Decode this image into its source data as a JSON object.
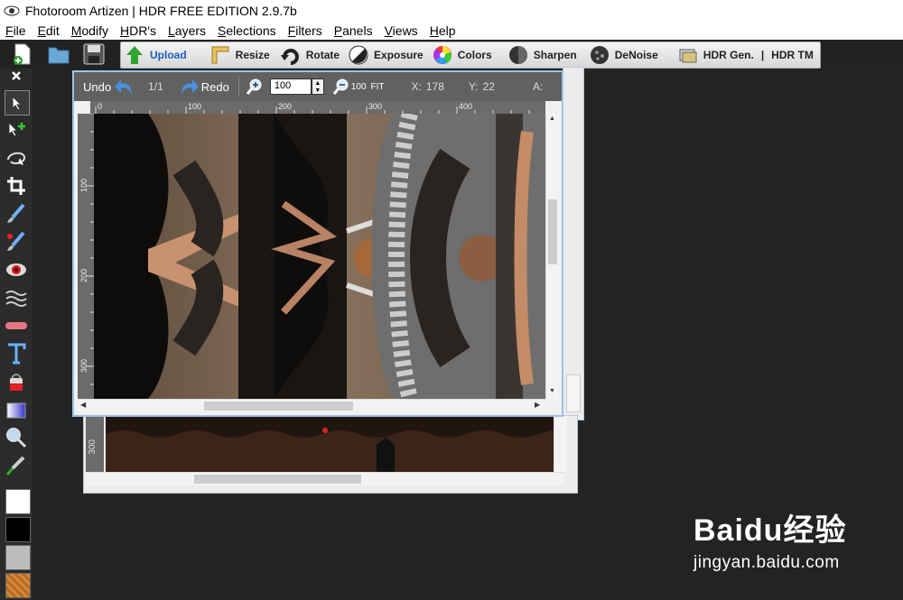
{
  "app": {
    "title": "Fhotoroom Artizen | HDR FREE EDITION 2.9.7b"
  },
  "menu": [
    "File",
    "Edit",
    "Modify",
    "HDR's",
    "Layers",
    "Selections",
    "Filters",
    "Panels",
    "Views",
    "Help"
  ],
  "toolbar": {
    "upload": "Upload",
    "resize": "Resize",
    "rotate": "Rotate",
    "exposure": "Exposure",
    "colors": "Colors",
    "sharpen": "Sharpen",
    "denoise": "DeNoise",
    "hdr_gen": "HDR Gen.",
    "separator": "|",
    "hdr_tm": "HDR TM"
  },
  "image_window": {
    "undo": "Undo",
    "page": "1/1",
    "redo": "Redo",
    "zoom_value": "100",
    "zoom_preset": "100",
    "fit": "FIT",
    "x_label": "X:",
    "x_value": "178",
    "y_label": "Y:",
    "y_value": "22",
    "a_label": "A:",
    "ruler_top": [
      "0",
      "100",
      "200",
      "300",
      "400"
    ],
    "ruler_left": [
      "100",
      "200",
      "300"
    ]
  },
  "back_window": {
    "ruler_left": [
      "300"
    ]
  },
  "colors": {
    "accent": "#1b5fbf",
    "window_border": "#9cc3e5",
    "foreground": "#ffffff",
    "background": "#000000"
  },
  "watermark": {
    "logo": "Baidu经验",
    "url": "jingyan.baidu.com"
  }
}
